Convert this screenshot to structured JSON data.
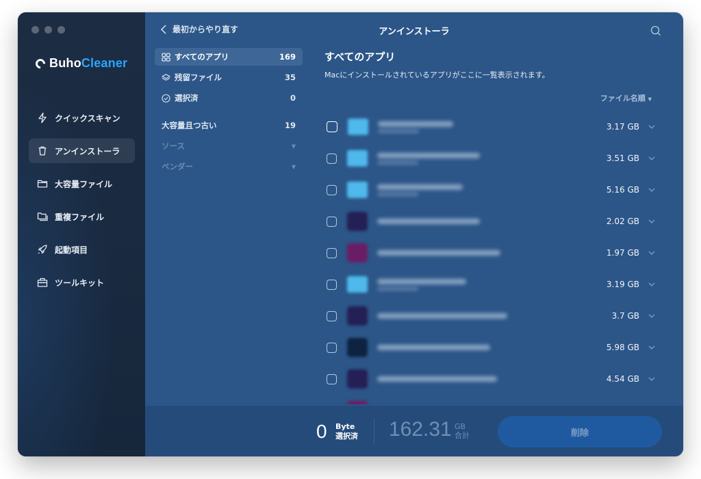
{
  "window": {
    "title": "アンインストーラ"
  },
  "brand": {
    "part1": "Buho",
    "part2": "Cleaner"
  },
  "header": {
    "back_label": "最初からやり直す",
    "title": "アンインストーラ"
  },
  "sidebar": {
    "items": [
      {
        "label": "クイックスキャン",
        "icon": "lightning-icon",
        "active": false
      },
      {
        "label": "アンインストーラ",
        "icon": "trash-icon",
        "active": true
      },
      {
        "label": "大容量ファイル",
        "icon": "folder-icon",
        "active": false
      },
      {
        "label": "重複ファイル",
        "icon": "duplicate-folder-icon",
        "active": false
      },
      {
        "label": "起動項目",
        "icon": "rocket-icon",
        "active": false
      },
      {
        "label": "ツールキット",
        "icon": "toolkit-icon",
        "active": false
      }
    ]
  },
  "categories": {
    "all": {
      "label": "すべてのアプリ",
      "count": "169"
    },
    "leftover": {
      "label": "残留ファイル",
      "count": "35"
    },
    "selected": {
      "label": "選択済",
      "count": "0"
    },
    "large_old": {
      "label": "大容量且つ古い",
      "count": "19"
    },
    "source": {
      "label": "ソース"
    },
    "vendor": {
      "label": "ベンダー"
    }
  },
  "list": {
    "title": "すべてのアプリ",
    "subtitle": "Macにインストールされているアプリがここに一覧表示されます。",
    "sort_label": "ファイル名順",
    "rows": [
      {
        "size": "3.17 GB"
      },
      {
        "size": "3.51 GB"
      },
      {
        "size": "5.16 GB"
      },
      {
        "size": "2.02 GB"
      },
      {
        "size": "1.97 GB"
      },
      {
        "size": "3.19 GB"
      },
      {
        "size": "3.7 GB"
      },
      {
        "size": "5.98 GB"
      },
      {
        "size": "4.54 GB"
      }
    ]
  },
  "footer": {
    "selected_value": "0",
    "selected_unit": "Byte",
    "selected_label": "選択済",
    "total_value": "162.31",
    "total_unit": "GB",
    "total_label": "合計",
    "delete_label": "削除"
  },
  "colors": {
    "accent": "#2aa7ff",
    "panel": "#2c5688",
    "sidebar": "#1c2c43",
    "button": "#1f5aa1"
  }
}
